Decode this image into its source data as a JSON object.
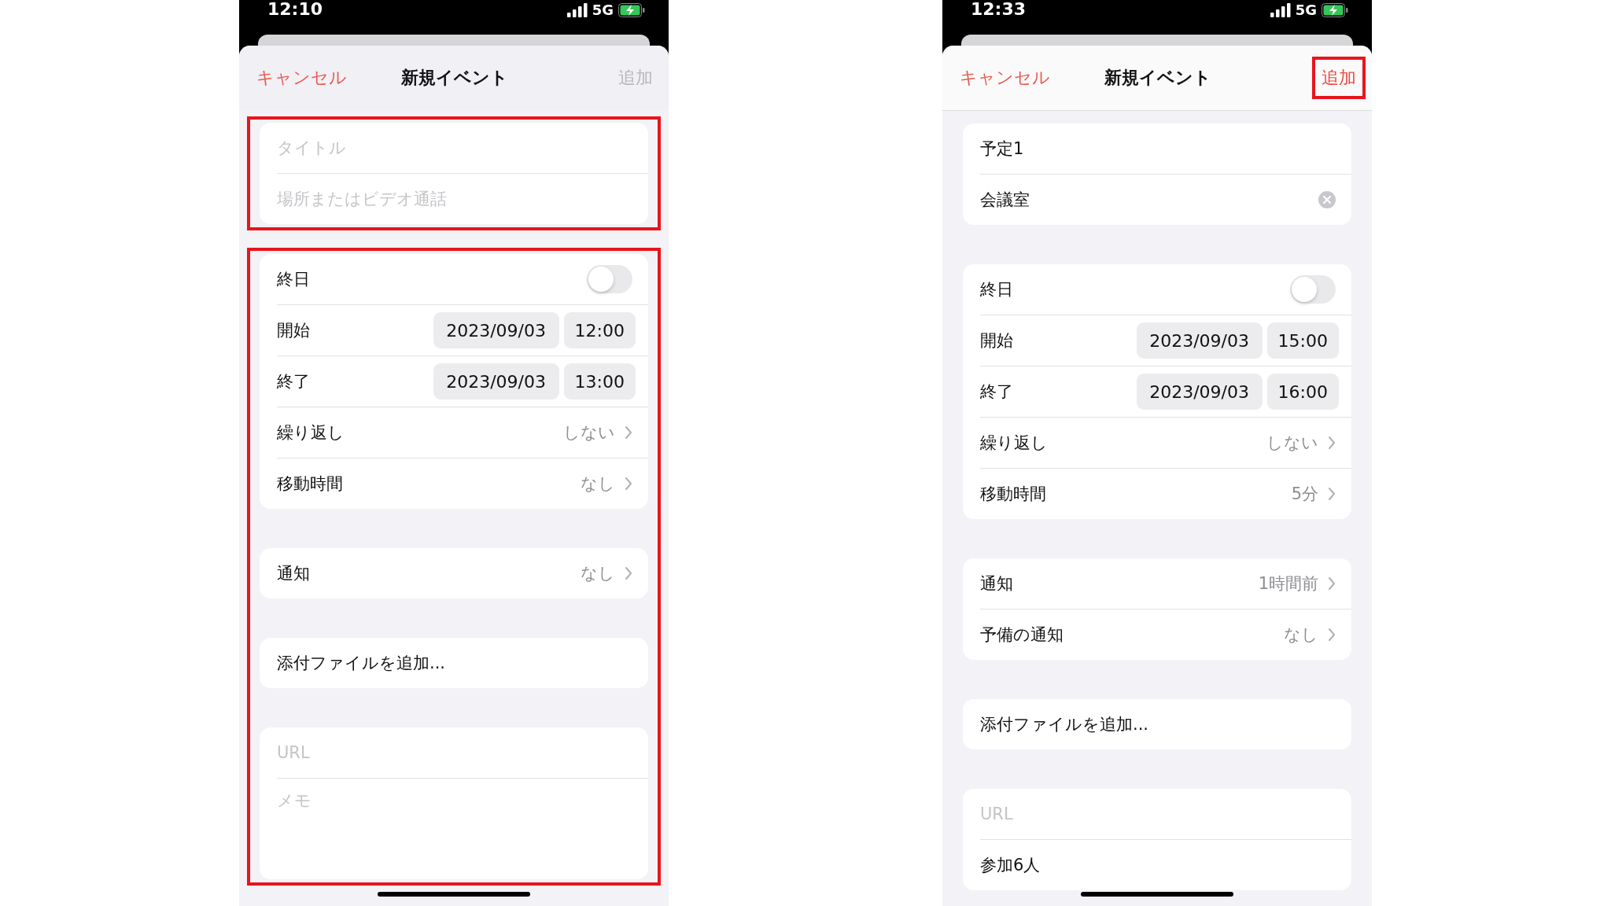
{
  "phones": [
    {
      "status_bar": {
        "time": "12:10",
        "network": "5G"
      },
      "nav": {
        "scrolled": false,
        "cancel": "キャンセル",
        "title": "新規イベント",
        "add": {
          "label": "追加",
          "disabled": true,
          "highlighted": false
        }
      },
      "sections": [
        {
          "highlighted": true,
          "groups": [
            [
              {
                "kind": "text",
                "placeholder": "タイトル"
              },
              {
                "kind": "text",
                "placeholder": "場所またはビデオ通話"
              }
            ]
          ]
        },
        {
          "highlighted": true,
          "groups": [
            [
              {
                "kind": "toggle",
                "label": "終日",
                "on": false
              },
              {
                "kind": "datetime",
                "label": "開始",
                "date": "2023/09/03",
                "time": "12:00"
              },
              {
                "kind": "datetime",
                "label": "終了",
                "date": "2023/09/03",
                "time": "13:00"
              },
              {
                "kind": "disclosure",
                "label": "繰り返し",
                "value": "しない"
              },
              {
                "kind": "disclosure",
                "label": "移動時間",
                "value": "なし"
              }
            ],
            [
              {
                "kind": "disclosure",
                "label": "通知",
                "value": "なし"
              }
            ],
            [
              {
                "kind": "action",
                "label": "添付ファイルを追加..."
              }
            ],
            [
              {
                "kind": "text",
                "placeholder": "URL"
              },
              {
                "kind": "note",
                "placeholder": "メモ"
              }
            ]
          ]
        }
      ]
    },
    {
      "status_bar": {
        "time": "12:33",
        "network": "5G"
      },
      "nav": {
        "scrolled": true,
        "cancel": "キャンセル",
        "title": "新規イベント",
        "add": {
          "label": "追加",
          "disabled": false,
          "highlighted": true
        }
      },
      "sections": [
        {
          "highlighted": false,
          "groups": [
            [
              {
                "kind": "text",
                "value": "予定1"
              },
              {
                "kind": "text",
                "value": "会議室",
                "clear_button": true
              }
            ],
            [
              {
                "kind": "toggle",
                "label": "終日",
                "on": false
              },
              {
                "kind": "datetime",
                "label": "開始",
                "date": "2023/09/03",
                "time": "15:00"
              },
              {
                "kind": "datetime",
                "label": "終了",
                "date": "2023/09/03",
                "time": "16:00"
              },
              {
                "kind": "disclosure",
                "label": "繰り返し",
                "value": "しない"
              },
              {
                "kind": "disclosure",
                "label": "移動時間",
                "value": "5分"
              }
            ],
            [
              {
                "kind": "disclosure",
                "label": "通知",
                "value": "1時間前"
              },
              {
                "kind": "disclosure",
                "label": "予備の通知",
                "value": "なし"
              }
            ],
            [
              {
                "kind": "action",
                "label": "添付ファイルを追加..."
              }
            ],
            [
              {
                "kind": "text",
                "placeholder": "URL"
              },
              {
                "kind": "action",
                "label": "参加6人"
              }
            ]
          ]
        }
      ]
    }
  ]
}
